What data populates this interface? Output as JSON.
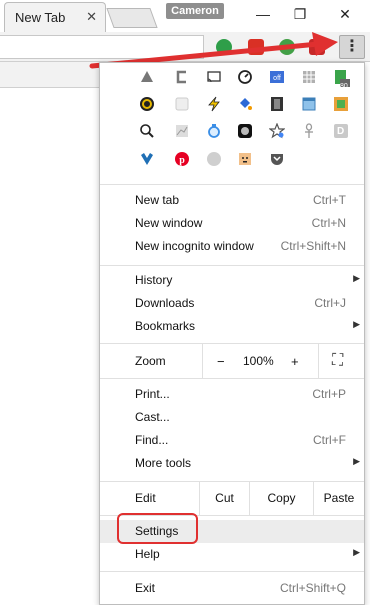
{
  "tab": {
    "title": "New Tab",
    "close": "✕"
  },
  "profile": {
    "name": "Cameron"
  },
  "window_controls": {
    "minimize": "—",
    "maximize": "❐",
    "close": "✕"
  },
  "toolbar": {
    "menu_glyph": "⋮"
  },
  "extensions_icons": [
    "drive-icon",
    "bracket-icon",
    "cast-icon",
    "gauge-icon",
    "off-icon",
    "grid-icon",
    "clipboard-80-icon",
    "color-wheel-icon",
    "ghost-icon",
    "bolt-icon",
    "paint-bucket-icon",
    "film-icon",
    "window-icon",
    "gradient-icon",
    "magnifier-icon",
    "chart-icon",
    "bottle-icon",
    "moon-icon",
    "star-icon",
    "ankh-icon",
    "d-icon",
    "heart-check-icon",
    "pinterest-icon",
    "circle-icon",
    "face-icon",
    "pocket-icon"
  ],
  "extension_badge": "80",
  "extension_d_label": "D",
  "menu": {
    "new_tab": {
      "label": "New tab",
      "shortcut": "Ctrl+T"
    },
    "new_window": {
      "label": "New window",
      "shortcut": "Ctrl+N"
    },
    "new_incognito": {
      "label": "New incognito window",
      "shortcut": "Ctrl+Shift+N"
    },
    "history": {
      "label": "History"
    },
    "downloads": {
      "label": "Downloads",
      "shortcut": "Ctrl+J"
    },
    "bookmarks": {
      "label": "Bookmarks"
    },
    "zoom": {
      "label": "Zoom",
      "minus": "−",
      "value": "100%",
      "plus": "+",
      "fullscreen": "⛶"
    },
    "print": {
      "label": "Print...",
      "shortcut": "Ctrl+P"
    },
    "cast": {
      "label": "Cast..."
    },
    "find": {
      "label": "Find...",
      "shortcut": "Ctrl+F"
    },
    "more_tools": {
      "label": "More tools"
    },
    "edit": {
      "label": "Edit",
      "cut": "Cut",
      "copy": "Copy",
      "paste": "Paste"
    },
    "settings": {
      "label": "Settings"
    },
    "help": {
      "label": "Help"
    },
    "exit": {
      "label": "Exit",
      "shortcut": "Ctrl+Shift+Q"
    },
    "submenu_arrow": "▶"
  },
  "colors": {
    "annotation": "#e03030",
    "menu_bg": "#ffffff",
    "settings_hover": "#ececec"
  }
}
